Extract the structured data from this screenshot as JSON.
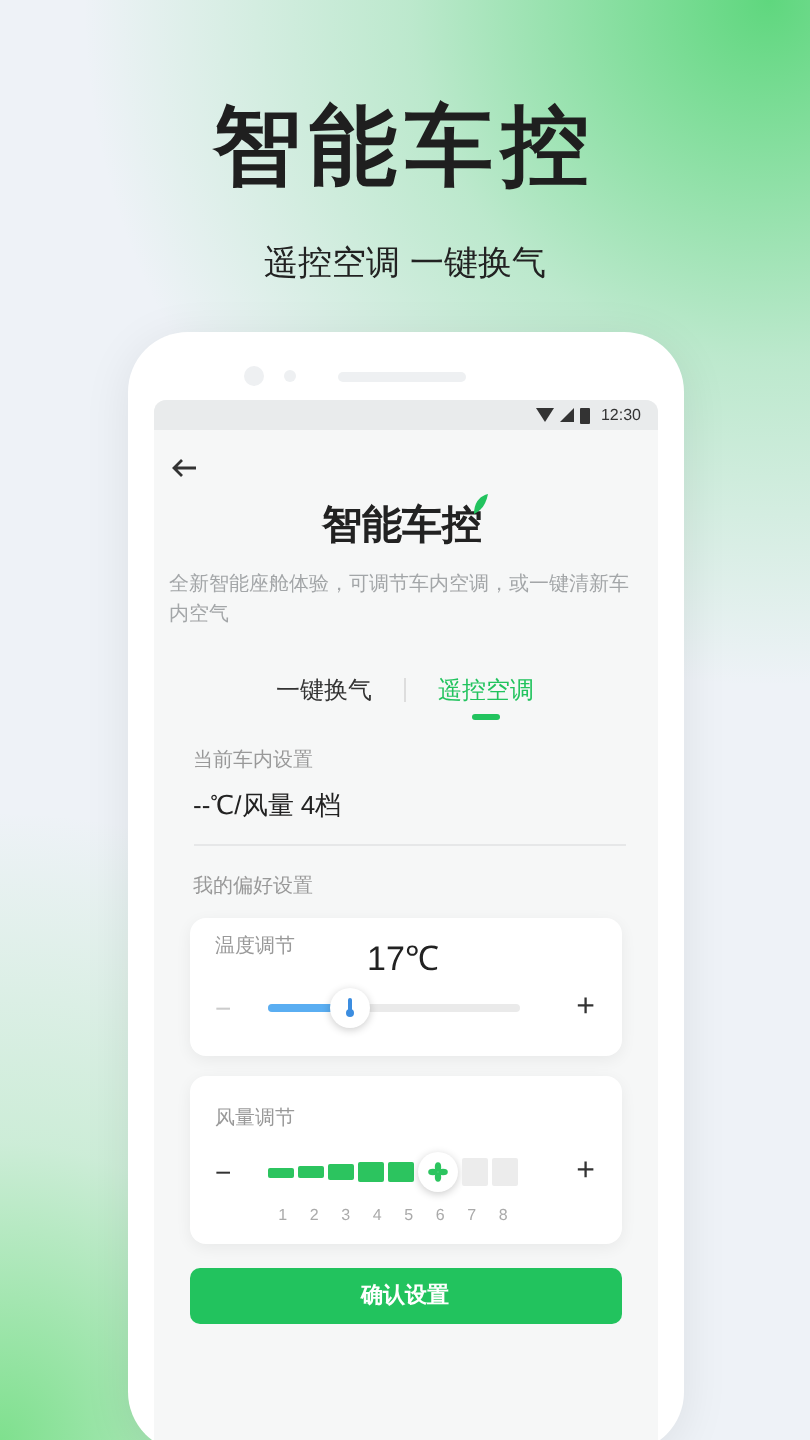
{
  "headline": "智能车控",
  "subtitle": "遥控空调 一键换气",
  "status_bar": {
    "time": "12:30"
  },
  "app": {
    "title": "智能车控",
    "description": "全新智能座舱体验，可调节车内空调，或一键清新车内空气"
  },
  "tabs": [
    {
      "label": "一键换气",
      "selected": false
    },
    {
      "label": "遥控空调",
      "selected": true
    }
  ],
  "current": {
    "label": "当前车内设置",
    "value": "--℃/风量 4档"
  },
  "preferences": {
    "label": "我的偏好设置"
  },
  "temperature": {
    "label": "温度调节",
    "reading": "17℃",
    "minus": "−",
    "plus": "+",
    "level": 0.33
  },
  "wind": {
    "label": "风量调节",
    "minus": "−",
    "plus": "+",
    "ticks": [
      {
        "label": "1",
        "selected": false
      },
      {
        "label": "2",
        "selected": false
      },
      {
        "label": "3",
        "selected": false
      },
      {
        "label": "4",
        "selected": false
      },
      {
        "label": "5",
        "selected": false
      },
      {
        "label": "6",
        "selected": true
      },
      {
        "label": "7",
        "selected": false
      },
      {
        "label": "8",
        "selected": false
      }
    ]
  },
  "confirm_button": "确认设置"
}
